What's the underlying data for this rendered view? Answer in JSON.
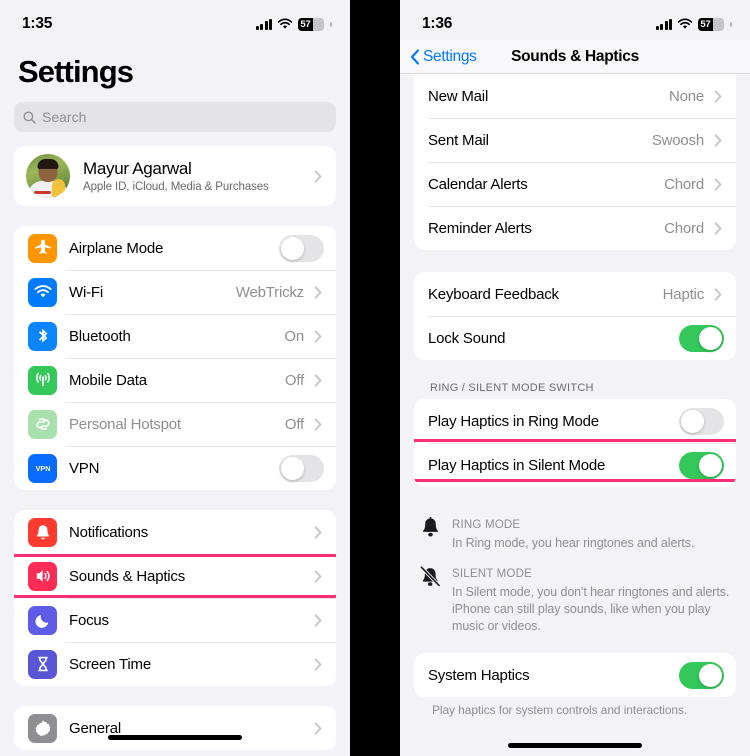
{
  "left": {
    "status": {
      "time": "1:35",
      "battery_percent": "57",
      "signal_icon": "cellular-bars-icon",
      "wifi_icon": "wifi-icon",
      "battery_icon": "battery-icon"
    },
    "title": "Settings",
    "search": {
      "placeholder": "Search",
      "icon": "search-icon"
    },
    "profile": {
      "name": "Mayur Agarwal",
      "subtitle": "Apple ID, iCloud, Media & Purchases",
      "avatar": "user-avatar"
    },
    "group_connectivity": [
      {
        "label": "Airplane Mode",
        "icon": "airplane-icon",
        "icon_color": "#FF9500",
        "control": "toggle",
        "value": "off"
      },
      {
        "label": "Wi-Fi",
        "icon": "wifi-icon",
        "icon_color": "#007AFF",
        "control": "value",
        "value": "WebTrickz"
      },
      {
        "label": "Bluetooth",
        "icon": "bluetooth-icon",
        "icon_color": "#0A84FF",
        "control": "value",
        "value": "On"
      },
      {
        "label": "Mobile Data",
        "icon": "cellular-icon",
        "icon_color": "#34C759",
        "control": "value",
        "value": "Off"
      },
      {
        "label": "Personal Hotspot",
        "icon": "hotspot-icon",
        "icon_color": "#A8E0AE",
        "control": "value",
        "value": "Off",
        "dimmed": true
      },
      {
        "label": "VPN",
        "icon": "vpn-icon",
        "icon_color": "#0A6CFF",
        "control": "toggle",
        "value": "off"
      }
    ],
    "group_alerts": [
      {
        "label": "Notifications",
        "icon": "notifications-bell-icon",
        "icon_color": "#FF3B30",
        "control": "chevron"
      },
      {
        "label": "Sounds & Haptics",
        "icon": "sounds-speaker-icon",
        "icon_color": "#FF2D55",
        "control": "chevron",
        "highlighted": true
      },
      {
        "label": "Focus",
        "icon": "focus-moon-icon",
        "icon_color": "#5E5CE6",
        "control": "chevron"
      },
      {
        "label": "Screen Time",
        "icon": "screen-time-hourglass-icon",
        "icon_color": "#5856D6",
        "control": "chevron"
      }
    ],
    "group_system": [
      {
        "label": "General",
        "icon": "general-gear-icon",
        "icon_color": "#8E8E93",
        "control": "chevron"
      }
    ]
  },
  "right": {
    "status": {
      "time": "1:36",
      "battery_percent": "57",
      "signal_icon": "cellular-bars-icon",
      "wifi_icon": "wifi-icon",
      "battery_icon": "battery-icon"
    },
    "nav": {
      "back_label": "Settings",
      "back_icon": "chevron-left-icon",
      "title": "Sounds & Haptics"
    },
    "group_sounds": [
      {
        "label": "New Mail",
        "value": "None"
      },
      {
        "label": "Sent Mail",
        "value": "Swoosh"
      },
      {
        "label": "Calendar Alerts",
        "value": "Chord"
      },
      {
        "label": "Reminder Alerts",
        "value": "Chord"
      }
    ],
    "group_feedback": [
      {
        "label": "Keyboard Feedback",
        "control": "value",
        "value": "Haptic"
      },
      {
        "label": "Lock Sound",
        "control": "toggle",
        "value": "on"
      }
    ],
    "ring_silent": {
      "header": "RING / SILENT MODE SWITCH",
      "rows": [
        {
          "label": "Play Haptics in Ring Mode",
          "control": "toggle",
          "value": "off"
        },
        {
          "label": "Play Haptics in Silent Mode",
          "control": "toggle",
          "value": "on",
          "highlighted": true
        }
      ]
    },
    "modes": [
      {
        "icon": "bell-icon",
        "title": "RING MODE",
        "desc": "In Ring mode, you hear ringtones and alerts."
      },
      {
        "icon": "bell-slash-icon",
        "title": "SILENT MODE",
        "desc": "In Silent mode, you don't hear ringtones and alerts. iPhone can still play sounds, like when you play music or videos."
      }
    ],
    "group_haptics": [
      {
        "label": "System Haptics",
        "control": "toggle",
        "value": "on"
      }
    ],
    "haptics_footer": "Play haptics for system controls and interactions."
  },
  "colors": {
    "highlight": "#FF2E74",
    "toggle_on": "#34C759",
    "toggle_off": "#E4E4E6",
    "accent_blue": "#007AFF"
  }
}
